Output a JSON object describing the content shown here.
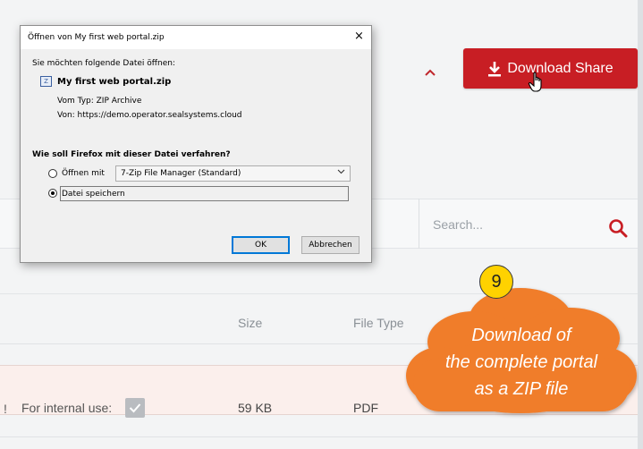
{
  "page": {
    "download_share_label": "Download Share",
    "search_placeholder": "Search...",
    "columns": {
      "size": "Size",
      "file_type": "File Type"
    },
    "row": {
      "bang": "!",
      "internal_label": "For internal use:",
      "internal_checked": true,
      "size": "59 KB",
      "file_type": "PDF"
    }
  },
  "dialog": {
    "title": "Öffnen von My first web portal.zip",
    "close": "×",
    "intro": "Sie möchten folgende Datei öffnen:",
    "file_name": "My first web portal.zip",
    "file_type": "Vom Typ: ZIP Archive",
    "file_from": "Von: https://demo.operator.sealsystems.cloud",
    "question": "Wie soll Firefox mit dieser Datei verfahren?",
    "open_with_label": "Öffnen mit",
    "open_with_app": "7-Zip File Manager (Standard)",
    "save_label": "Datei speichern",
    "selected_option": "save",
    "ok_label": "OK",
    "cancel_label": "Abbrechen"
  },
  "annotation": {
    "step": "9",
    "lines": [
      "Download of",
      "the complete portal",
      "as a ZIP file"
    ]
  },
  "colors": {
    "brand_red": "#c81e24",
    "cloud_orange": "#f07d2b",
    "badge_yellow": "#ffd200"
  }
}
